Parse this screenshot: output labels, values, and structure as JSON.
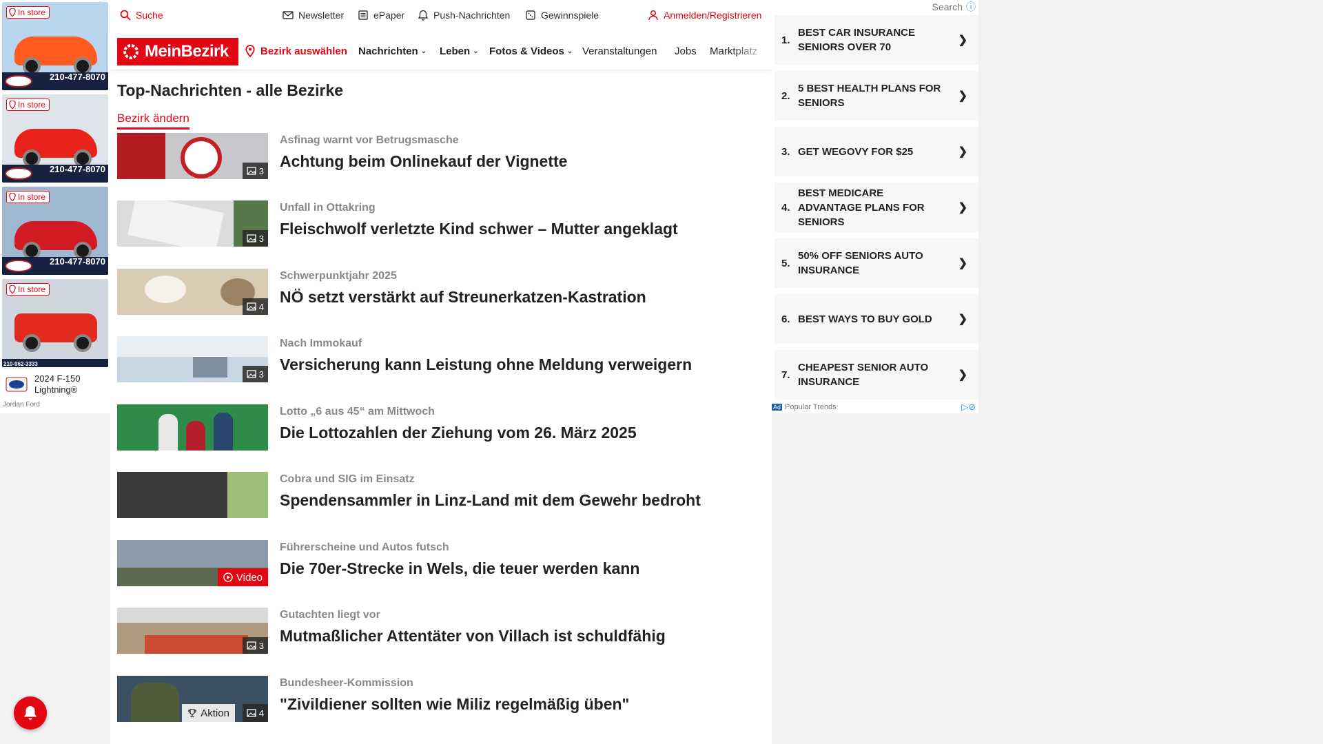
{
  "colors": {
    "brand": "#e30613",
    "text": "#222222",
    "kicker": "#888888"
  },
  "left_ad": {
    "tiles": [
      {
        "badge": "In store",
        "phone": "210-477-8070",
        "car_color": "#ff5a1f",
        "sky": "#b9d6ee"
      },
      {
        "badge": "In store",
        "phone": "210-477-8070",
        "car_color": "#e8231c",
        "sky": "#dfe4ea"
      },
      {
        "badge": "In store",
        "phone": "210-477-8070",
        "car_color": "#d21b22",
        "sky": "#9fb7cf"
      },
      {
        "badge": "In store",
        "phone": "210-962-3333",
        "car_color": "#e22a1e",
        "sky": "#cfd6de"
      }
    ],
    "model": "2024 F-150 Lightning®",
    "dealer": "Jordan Ford"
  },
  "topbar": {
    "search": "Suche",
    "newsletter": "Newsletter",
    "epaper": "ePaper",
    "push": "Push-Nachrichten",
    "games": "Gewinnspiele",
    "login": "Anmelden/Registrieren"
  },
  "nav": {
    "logo": "MeinBezirk",
    "district": "Bezirk auswählen",
    "items": [
      "Nachrichten",
      "Leben",
      "Fotos & Videos",
      "Veranstaltungen",
      "Jobs",
      "Marktplatz"
    ]
  },
  "section": {
    "title": "Top-Nachrichten - alle Bezirke",
    "change": "Bezirk ändern"
  },
  "articles": [
    {
      "kicker": "Asfinag warnt vor Betrugsmasche",
      "headline": "Achtung beim Onlinekauf der Vignette",
      "count": "3",
      "thumb_color": "#c8c8cc"
    },
    {
      "kicker": "Unfall in Ottakring",
      "headline": "Fleischwolf verletzte Kind schwer – Mutter angeklagt",
      "count": "3",
      "thumb_color": "#dcdcdc"
    },
    {
      "kicker": "Schwerpunktjahr 2025",
      "headline": "NÖ setzt verstärkt auf Streunerkatzen-Kastration",
      "count": "4",
      "thumb_color": "#d8ccb4"
    },
    {
      "kicker": "Nach Immokauf",
      "headline": "Versicherung kann Leistung ohne Meldung verweigern",
      "count": "3",
      "thumb_color": "#c9d6e4"
    },
    {
      "kicker": "Lotto „6 aus 45“ am Mittwoch",
      "headline": "Die Lottozahlen der Ziehung vom 26. März 2025",
      "count": "",
      "thumb_color": "#2e8b4a"
    },
    {
      "kicker": "Cobra und SIG im Einsatz",
      "headline": "Spendensammler in Linz-Land mit dem Gewehr bedroht",
      "count": "",
      "thumb_color": "#6a6a6a"
    },
    {
      "kicker": "Führerscheine und Autos futsch",
      "headline": "Die 70er-Strecke in Wels, die teuer werden kann",
      "video": "Video",
      "thumb_color": "#8a9aa8"
    },
    {
      "kicker": "Gutachten liegt vor",
      "headline": "Mutmaßlicher Attentäter von Villach ist schuldfähig",
      "count": "3",
      "thumb_color": "#b09a80"
    },
    {
      "kicker": "Bundesheer-Kommission",
      "headline": "\"Zivildiener sollten wie Miliz regelmäßig üben\"",
      "count": "4",
      "aktion": "Aktion",
      "thumb_color": "#3c5064"
    }
  ],
  "right_ad": {
    "search": "Search",
    "items": [
      {
        "num": "1.",
        "text": "BEST CAR INSURANCE SENIORS OVER 70"
      },
      {
        "num": "2.",
        "text": "5 BEST HEALTH PLANS FOR SENIORS"
      },
      {
        "num": "3.",
        "text": "GET WEGOVY FOR $25"
      },
      {
        "num": "4.",
        "text": "BEST MEDICARE ADVANTAGE PLANS FOR SENIORS"
      },
      {
        "num": "5.",
        "text": "50% OFF SENIORS AUTO INSURANCE"
      },
      {
        "num": "6.",
        "text": "BEST WAYS TO BUY GOLD"
      },
      {
        "num": "7.",
        "text": "CHEAPEST SENIOR AUTO INSURANCE"
      }
    ],
    "arrow": "❯",
    "ad_label": "Ad",
    "footer": "Popular Trends"
  }
}
